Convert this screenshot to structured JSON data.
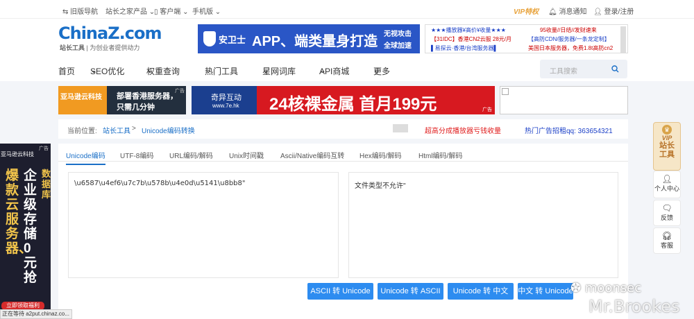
{
  "topbar": {
    "old_nav": "旧版导航",
    "products": "站长之家产品",
    "client": "客户端",
    "mobile": "手机版",
    "vip": "VIP特权",
    "notice": "消息通知",
    "login": "登录/注册"
  },
  "logo": {
    "text": "ChinaZ.com",
    "station": "站长工具",
    "slogan": "为创业者提供动力"
  },
  "ad_top": {
    "brand": "安卫士",
    "headline": "APP、端类量身打造",
    "sub1": "无视攻击",
    "sub2": "全球加速"
  },
  "ad_text": {
    "l1": "★★★播放器¥高价¥收量★★★",
    "l2": "【31IDC】香港CN2云服 28元/月",
    "l3": "▌易探云·香港/台湾服务器▌",
    "r1": "95收量//日结//发财速来",
    "r2": "【高防CDN/服务器/一条龙定制】",
    "r3": "美国日本服务器，免费1.8t高防cn2"
  },
  "nav": {
    "home": "首页",
    "seo": "SEO优化",
    "weight": "权重查询",
    "hot": "热门工具",
    "lexicon": "星网词库",
    "api": "API商城",
    "more": "更多",
    "search_placeholder": "工具搜索"
  },
  "banners": {
    "amazon_title": "亚马逊云科技",
    "amazon_line1": "部署香港服务器，",
    "amazon_line2": "只需几分钟",
    "ad_mark": "广告",
    "qiyi_brand": "奇异互动",
    "qiyi_url": "www.7e.hk",
    "qiyi_headline": "24核裸金属  首月199元"
  },
  "crumb": {
    "label": "当前位置:",
    "c1": "站长工具",
    "sep": ">",
    "c2": "Unicode编码转换",
    "promo": "超高分成播放器亏钱收量",
    "hotline": "热门广告招租qq: 363654321"
  },
  "tabs": [
    "Unicode编码",
    "UTF-8编码",
    "URL编码/解码",
    "Unix时间戳",
    "Ascii/Native编码互转",
    "Hex编码/解码",
    "Html编码/解码"
  ],
  "input_text": "\\u6587\\u4ef6\\u7c7b\\u578b\\u4e0d\\u5141\\u8bb8\"",
  "output_text": "文件类型不允许\"",
  "buttons": [
    "ASCII 转 Unicode",
    "Unicode 转 ASCII",
    "Unicode 转 中文",
    "中文 转 Unicode"
  ],
  "left_ad": {
    "title": "亚马逊云科技",
    "ad_mark": "广告",
    "col1": "爆款云服务器、",
    "col2": "企业级存储0元抢",
    "col3": "数据库",
    "cta": "立即领取福利"
  },
  "right_side": {
    "vip": "VIP",
    "vip_text": "站长工具",
    "personal": "个人中心",
    "feedback": "反馈",
    "service": "客服"
  },
  "status_text": "正在等待 a2put.chinaz.co...",
  "watermark": {
    "wechat": "moonsec",
    "name": "Mr.Brookes"
  },
  "colors": {
    "accent": "#1a6fc7",
    "button": "#2d8cf0",
    "promo_red": "#e02020"
  }
}
